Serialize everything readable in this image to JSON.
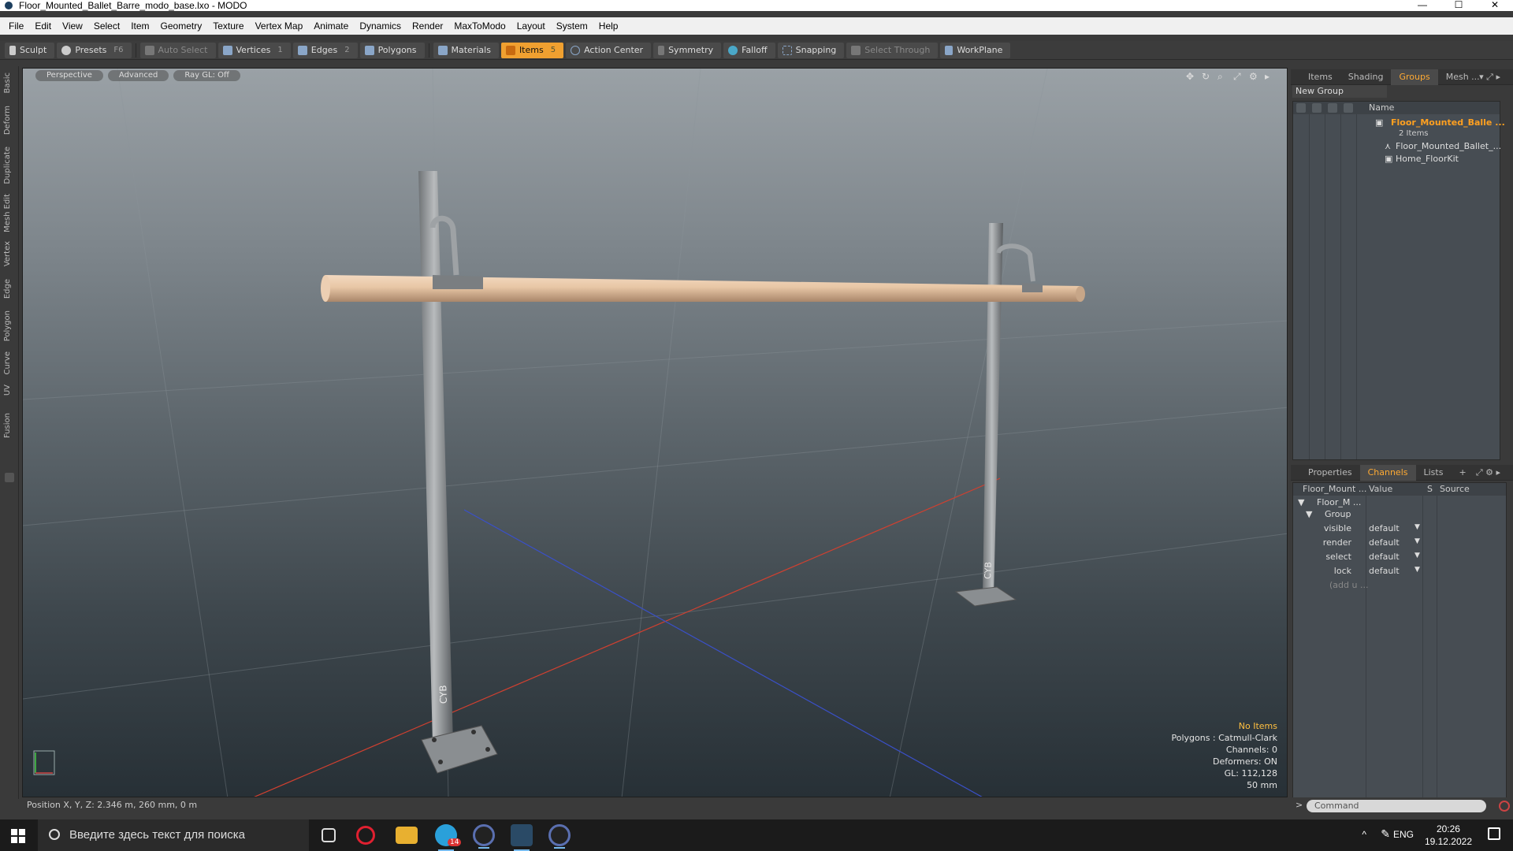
{
  "window": {
    "title": "Floor_Mounted_Ballet_Barre_modo_base.lxo - MODO",
    "minimize": "—",
    "maximize": "☐",
    "close": "✕"
  },
  "menu": [
    "File",
    "Edit",
    "View",
    "Select",
    "Item",
    "Geometry",
    "Texture",
    "Vertex Map",
    "Animate",
    "Dynamics",
    "Render",
    "MaxToModo",
    "Layout",
    "System",
    "Help"
  ],
  "toolbar": {
    "sculpt": "Sculpt",
    "presets": "Presets",
    "presets_key": "F6",
    "auto_select": "Auto Select",
    "vertices": "Vertices",
    "vertices_num": "1",
    "edges": "Edges",
    "edges_num": "2",
    "polygons": "Polygons",
    "materials": "Materials",
    "items": "Items",
    "items_num": "5",
    "action_center": "Action Center",
    "symmetry": "Symmetry",
    "falloff": "Falloff",
    "snapping": "Snapping",
    "select_through": "Select Through",
    "workplane": "WorkPlane"
  },
  "left_tabs": [
    "Basic",
    "Deform",
    "Duplicate",
    "Mesh Edit",
    "Vertex",
    "Edge",
    "Polygon",
    "Curve",
    "UV",
    "Fusion"
  ],
  "viewport": {
    "view_mode": "Perspective",
    "advanced": "Advanced",
    "raygl": "Ray GL: Off",
    "stats": {
      "items": "No Items",
      "polygons": "Polygons : Catmull-Clark",
      "channels": "Channels: 0",
      "deformers": "Deformers: ON",
      "gl": "GL: 112,128",
      "scale": "50 mm"
    },
    "position": "Position X, Y, Z:   2.346 m, 260 mm, 0 m"
  },
  "right_panel": {
    "top_tabs": [
      "Items",
      "Shading",
      "Groups",
      "Mesh ..."
    ],
    "active_top_tab": "Groups",
    "new_group": "New Group",
    "name_header": "Name",
    "group_name": "Floor_Mounted_Balle ...",
    "group_count": "2 Items",
    "children": [
      "Floor_Mounted_Ballet_...",
      "Home_FloorKit"
    ],
    "bottom_tabs": [
      "Properties",
      "Channels",
      "Lists",
      "+"
    ],
    "active_bottom_tab": "Channels",
    "chan_headers": {
      "name": "Floor_Mount ...",
      "value": "Value",
      "s": "S",
      "source": "Source"
    },
    "chan_root": "Floor_M ...",
    "chan_group": "Group",
    "channels": [
      {
        "label": "visible",
        "value": "default"
      },
      {
        "label": "render",
        "value": "default"
      },
      {
        "label": "select",
        "value": "default"
      },
      {
        "label": "lock",
        "value": "default"
      }
    ],
    "add_user": "(add u ...",
    "command_placeholder": "Command"
  },
  "taskbar": {
    "search_placeholder": "Введите здесь текст для поиска",
    "lang": "ENG",
    "time": "20:26",
    "date": "19.12.2022",
    "telegram_badge": "14"
  },
  "colors": {
    "accent": "#f0a030",
    "selected_text": "#ffa020",
    "x_axis": "#d04030",
    "z_axis": "#3a50c8"
  }
}
